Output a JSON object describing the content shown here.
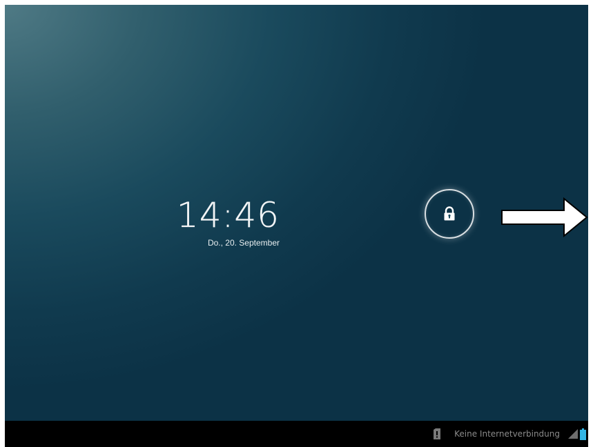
{
  "lockscreen": {
    "time": "14:46",
    "date": "Do., 20. September",
    "unlock_icon": "lock-icon",
    "hint_arrow": "right-arrow"
  },
  "status_bar": {
    "connection_text": "Keine Internetverbindung",
    "icons": [
      "sd-card-warning-icon",
      "signal-icon",
      "battery-icon"
    ]
  },
  "colors": {
    "background_dark": "#0c3246",
    "background_light": "#4f7a85",
    "navbar": "#000000",
    "battery": "#33b5e5",
    "status_text": "#8a8a8a"
  }
}
